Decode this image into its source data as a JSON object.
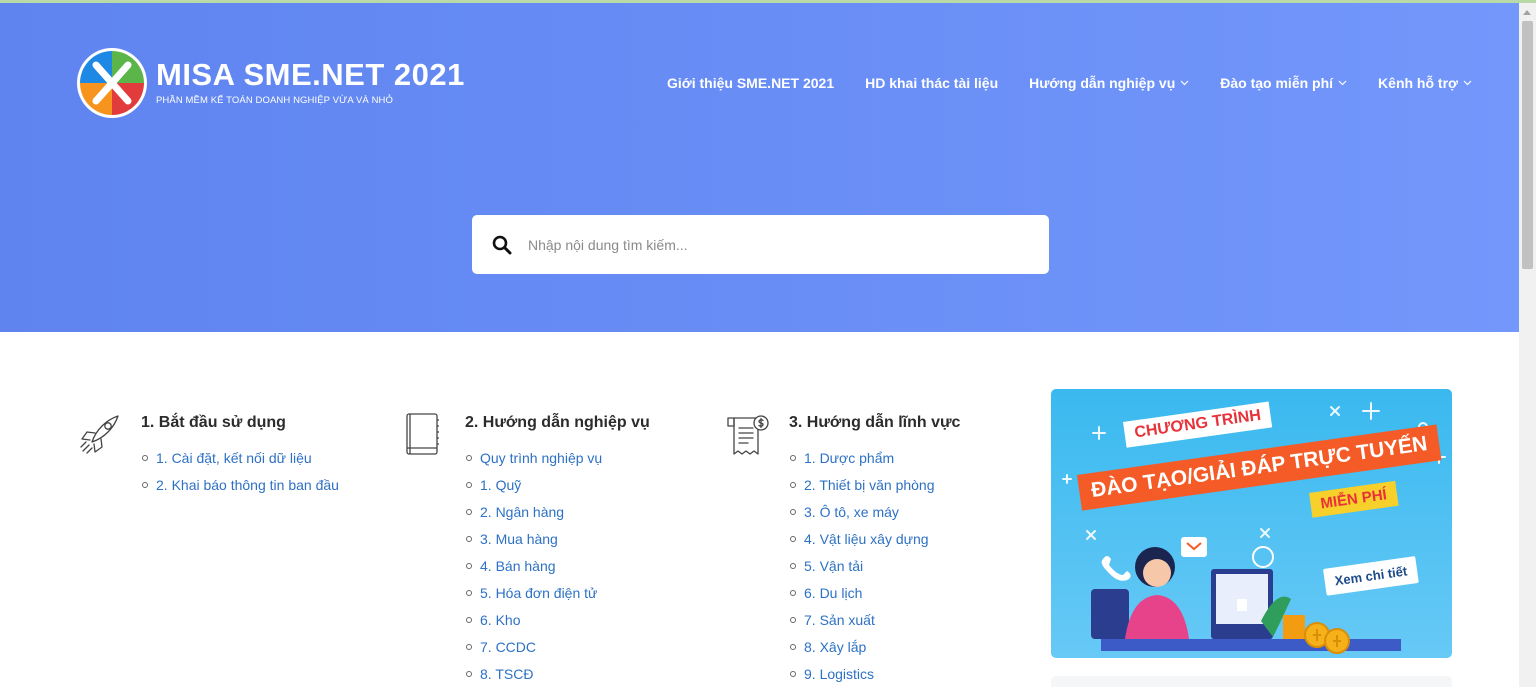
{
  "brand": {
    "title": "MISA SME.NET 2021",
    "subtitle": "PHẦN MỀM KẾ TOÁN DOANH NGHIỆP VỪA VÀ NHỎ"
  },
  "nav": {
    "items": [
      {
        "label": "Giới thiệu SME.NET 2021",
        "dropdown": false
      },
      {
        "label": "HD khai thác tài liệu",
        "dropdown": false
      },
      {
        "label": "Hướng dẫn nghiệp vụ",
        "dropdown": true
      },
      {
        "label": "Đào tạo miễn phí",
        "dropdown": true
      },
      {
        "label": "Kênh hỗ trợ",
        "dropdown": true
      }
    ]
  },
  "search": {
    "placeholder": "Nhập nội dung tìm kiếm...",
    "value": ""
  },
  "sections": [
    {
      "icon": "rocket-icon",
      "title": "1. Bắt đầu sử dụng",
      "items": [
        "1. Cài đặt, kết nối dữ liệu",
        "2. Khai báo thông tin ban đầu"
      ]
    },
    {
      "icon": "book-icon",
      "title": "2. Hướng dẫn nghiệp vụ",
      "items": [
        "Quy trình nghiệp vụ",
        "1. Quỹ",
        "2. Ngân hàng",
        "3. Mua hàng",
        "4. Bán hàng",
        "5. Hóa đơn điện tử",
        "6. Kho",
        "7. CCDC",
        "8. TSCĐ"
      ]
    },
    {
      "icon": "invoice-icon",
      "title": "3. Hướng dẫn lĩnh vực",
      "items": [
        "1. Dược phẩm",
        "2. Thiết bị văn phòng",
        "3. Ô tô, xe máy",
        "4. Vật liệu xây dựng",
        "5. Vận tải",
        "6. Du lịch",
        "7. Sản xuất",
        "8. Xây lắp",
        "9. Logistics"
      ]
    }
  ],
  "banner": {
    "line1": "CHƯƠNG TRÌNH",
    "line2": "ĐÀO TẠO/GIẢI ĐÁP TRỰC TUYẾN",
    "line3": "MIỄN PHÍ",
    "cta": "Xem chi tiết"
  },
  "colors": {
    "hero": "#6a8ff6",
    "link": "#2d71c4",
    "accent_orange": "#f45b26"
  }
}
